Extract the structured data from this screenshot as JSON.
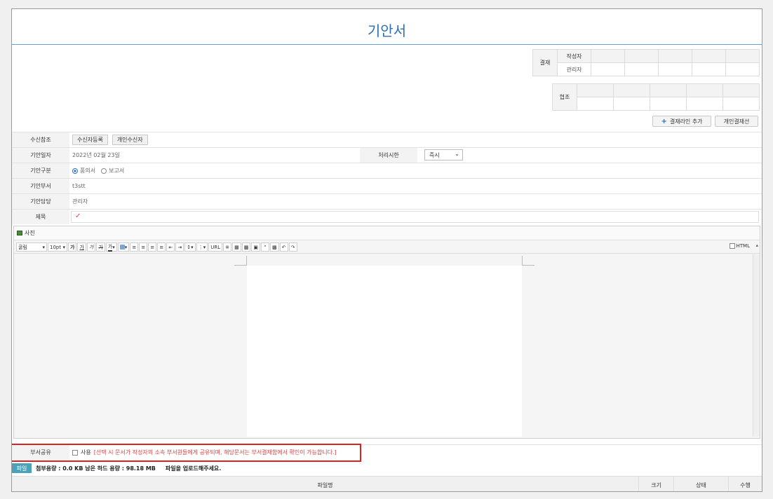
{
  "header": {
    "title": "기안서"
  },
  "approval": {
    "side_label": "결재",
    "role_label": "작성자",
    "name_label": "관리자",
    "coop_label": "협조"
  },
  "buttons": {
    "add_line": "결재라인 추가",
    "personal_line": "개인결재선"
  },
  "form": {
    "receiver_ref": {
      "label": "수신참조",
      "btn_register": "수신자등록",
      "btn_personal": "개인수신자"
    },
    "draft_date": {
      "label": "기안일자",
      "value": "2022년 02월 23일"
    },
    "deadline": {
      "label": "처리시한",
      "value": "즉시"
    },
    "draft_type": {
      "label": "기안구분",
      "option1": "품의서",
      "option2": "보고서",
      "selected": "품의서"
    },
    "dept": {
      "label": "기안부서",
      "value": "t3stt"
    },
    "manager": {
      "label": "기안담당",
      "value": "관리자"
    },
    "subject": {
      "label": "제목",
      "value": ""
    }
  },
  "editor": {
    "photo_label": "사진",
    "font_name": "굴림",
    "font_size": "10pt",
    "bold": "가",
    "underline": "가",
    "italic": "가",
    "strike": "가",
    "font_color": "가",
    "url": "URL",
    "html_label": "HTML"
  },
  "share": {
    "label": "부서공유",
    "use_label": "사용",
    "warning": "[선택 시 문서가 작성자의 소속 부서원들에게 공유되며, 해당문서는 부서결재함에서 확인이 가능합니다.]"
  },
  "files": {
    "button": "파일",
    "usage": "첨부용량 : 0.0 KB 남은 하드 용량 : 98.18 MB",
    "hint": "파일을 업로드해주세요.",
    "col_name": "파일명",
    "col_size": "크기",
    "col_status": "상태",
    "col_action": "수행"
  }
}
